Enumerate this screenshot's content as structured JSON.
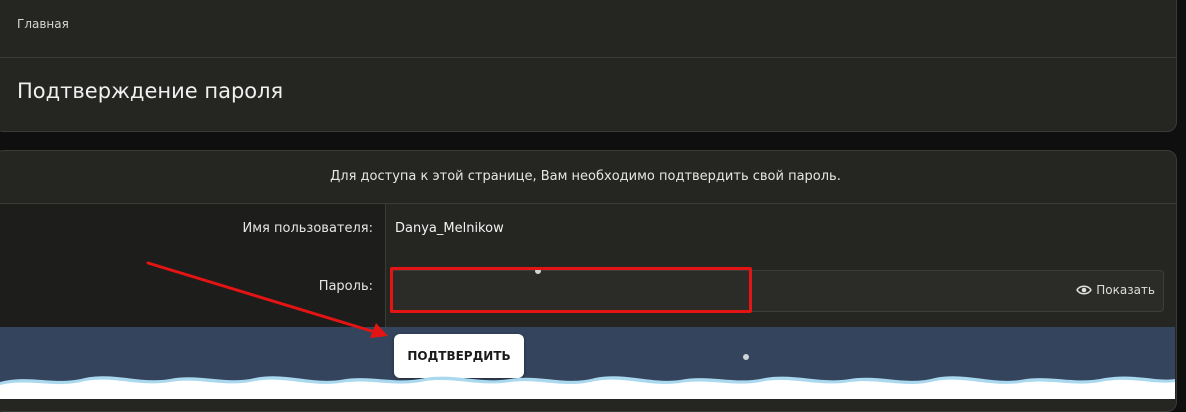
{
  "header": {
    "breadcrumb": "Главная",
    "title": "Подтверждение пароля"
  },
  "form": {
    "notice": "Для доступа к этой странице, Вам необходимо подтвердить свой пароль.",
    "username_label": "Имя пользователя:",
    "username_value": "Danya_Melnikow",
    "password_label": "Пароль:",
    "password_value": "",
    "show_label": "Показать",
    "submit_label": "ПОДТВЕРДИТЬ"
  },
  "annotation": {
    "highlight_color": "#e41414",
    "arrow_color": "#e41414"
  },
  "colors": {
    "background": "#0f0f0f",
    "panel": "#252522",
    "footer": "#34445d"
  },
  "icons": {
    "show": "eye-icon"
  }
}
